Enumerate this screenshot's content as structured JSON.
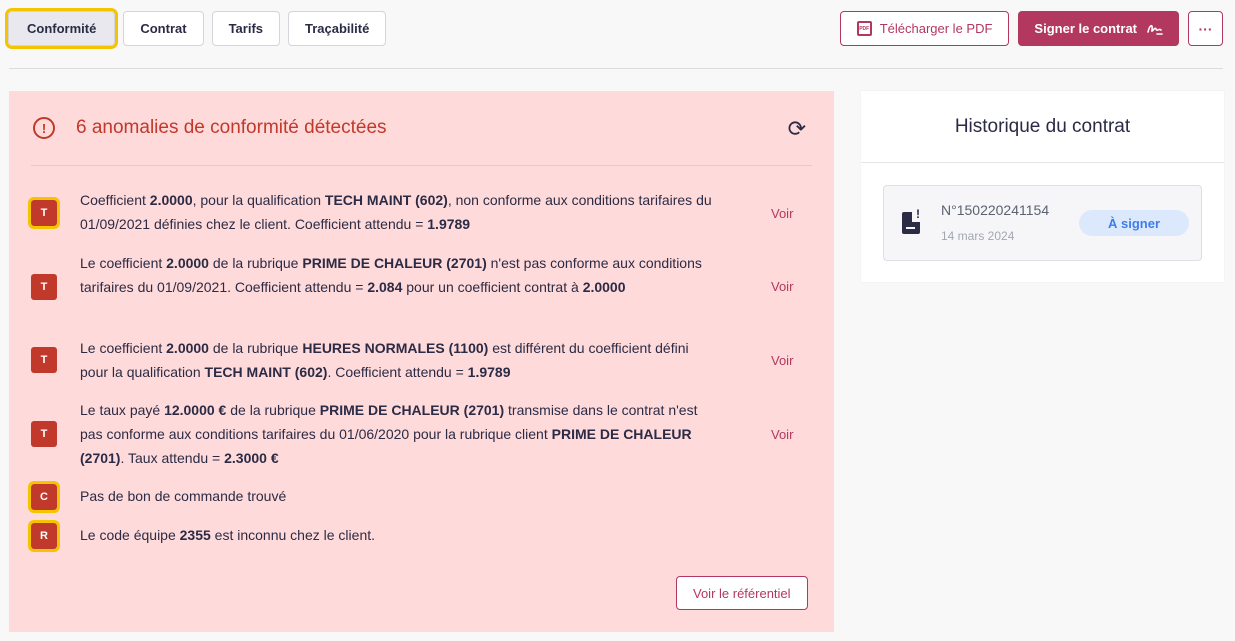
{
  "tabs": [
    {
      "label": "Conformité",
      "active": true
    },
    {
      "label": "Contrat"
    },
    {
      "label": "Tarifs"
    },
    {
      "label": "Traçabilité"
    }
  ],
  "actions": {
    "download_pdf": "Télécharger le PDF",
    "pdf_icon_text": "PDF",
    "sign_contract": "Signer le contrat",
    "more": "···"
  },
  "compliance": {
    "title": "6 anomalies de conformité détectées",
    "view_label": "Voir",
    "referential_button": "Voir le référentiel",
    "anomalies": [
      {
        "type": "T",
        "segments": [
          "Coefficient ",
          "2.0000",
          ", pour la qualification ",
          "TECH MAINT (602)",
          ", non conforme aux conditions tarifaires du 01/09/2021 définies chez le client. Coefficient attendu = ",
          "1.9789"
        ],
        "has_view": true
      },
      {
        "type": "T",
        "segments": [
          "Le coefficient ",
          "2.0000",
          " de la rubrique ",
          "PRIME DE CHALEUR (2701)",
          " n'est pas conforme aux conditions tarifaires du 01/09/2021. Coefficient attendu = ",
          "2.084",
          " pour un coefficient contrat à ",
          "2.0000"
        ],
        "has_view": true
      },
      {
        "type": "T",
        "segments": [
          "Le coefficient ",
          "2.0000",
          " de la rubrique ",
          "HEURES NORMALES (1100)",
          " est différent du coefficient défini pour la qualification ",
          "TECH MAINT (602)",
          ". Coefficient attendu = ",
          "1.9789"
        ],
        "has_view": true
      },
      {
        "type": "T",
        "segments": [
          "Le taux payé ",
          "12.0000 €",
          " de la rubrique ",
          "PRIME DE CHALEUR (2701)",
          " transmise dans le contrat n'est pas conforme aux conditions tarifaires du 01/06/2020 pour la rubrique client ",
          "PRIME DE CHALEUR (2701)",
          ". Taux attendu = ",
          "2.3000 €"
        ],
        "has_view": true
      },
      {
        "type": "C",
        "segments": [
          "Pas de bon de commande trouvé"
        ],
        "has_view": false
      },
      {
        "type": "R",
        "segments": [
          "Le code équipe ",
          "2355",
          " est inconnu chez le client."
        ],
        "has_view": false
      }
    ]
  },
  "history": {
    "title": "Historique du contrat",
    "contract_number": "N°150220241154",
    "date": "14 mars 2024",
    "status": "À signer",
    "doc_mark": "!"
  },
  "colors": {
    "accent": "#b3385f",
    "alert": "#c0392b",
    "panel_bg": "#ffdada",
    "highlight": "#f5c400",
    "status_blue": "#3f7ee8"
  }
}
